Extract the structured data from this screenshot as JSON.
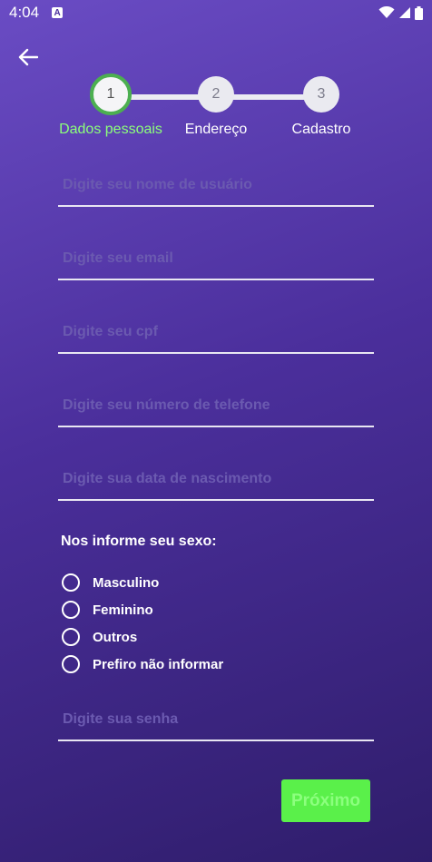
{
  "status_bar": {
    "time": "4:04",
    "app_icon": "A"
  },
  "stepper": {
    "steps": [
      {
        "number": "1",
        "label": "Dados pessoais"
      },
      {
        "number": "2",
        "label": "Endereço"
      },
      {
        "number": "3",
        "label": "Cadastro"
      }
    ],
    "active_color": "#4caf50",
    "active_label_color": "#8cff7a"
  },
  "form": {
    "username_placeholder": "Digite seu nome de usuário",
    "email_placeholder": "Digite seu email",
    "cpf_placeholder": "Digite seu cpf",
    "phone_placeholder": "Digite seu número de telefone",
    "birthdate_placeholder": "Digite sua data de nascimento",
    "gender_title": "Nos informe seu sexo:",
    "gender_options": [
      "Masculino",
      "Feminino",
      "Outros",
      "Prefiro não informar"
    ],
    "password_placeholder": "Digite sua senha"
  },
  "next_button": {
    "label": "Próximo",
    "color": "#5af04a"
  }
}
